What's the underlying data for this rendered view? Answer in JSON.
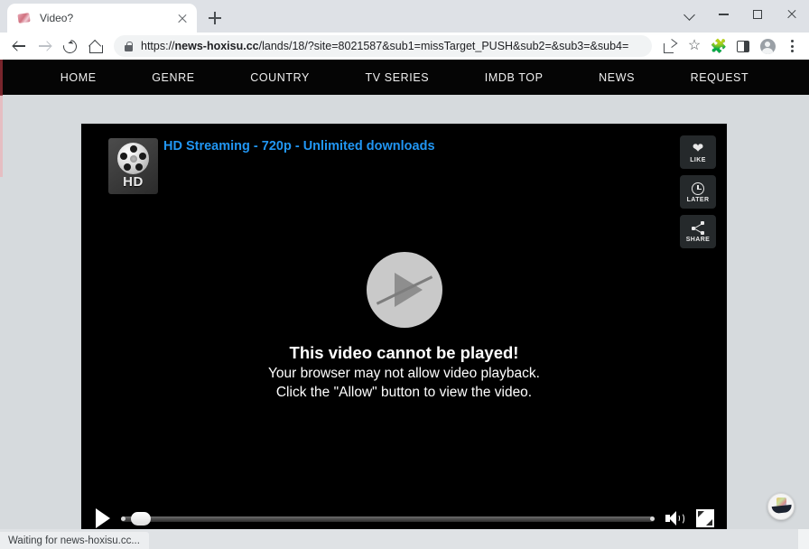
{
  "browser": {
    "tab": {
      "title": "Video?",
      "favicon": "page-favicon",
      "close_icon": "close-icon"
    },
    "new_tab_icon": "plus-icon",
    "window_controls": {
      "tab_search_icon": "chevron-down-icon",
      "minimize_icon": "minimize-icon",
      "maximize_icon": "maximize-icon",
      "close_icon": "close-icon"
    },
    "toolbar": {
      "back_icon": "back-arrow-icon",
      "forward_icon": "forward-arrow-icon",
      "reload_icon": "reload-icon",
      "home_icon": "home-icon",
      "lock_icon": "lock-icon",
      "url": "https://news-hoxisu.cc/lands/18/?site=8021587&sub1=missTarget_PUSH&sub2=&sub3=&sub4=",
      "url_host": "news-hoxisu.cc",
      "url_prefix": "https://",
      "url_path": "/lands/18/?site=8021587&sub1=missTarget_PUSH&sub2=&sub3=&sub4=",
      "share_icon": "share-icon",
      "bookmark_icon": "star-icon",
      "extensions_icon": "puzzle-icon",
      "side_panel_icon": "side-panel-icon",
      "profile_icon": "avatar-icon",
      "menu_icon": "three-dot-menu-icon"
    }
  },
  "site_nav": {
    "items": [
      {
        "label": "HOME"
      },
      {
        "label": "GENRE"
      },
      {
        "label": "COUNTRY"
      },
      {
        "label": "TV SERIES"
      },
      {
        "label": "IMDB TOP"
      },
      {
        "label": "NEWS"
      },
      {
        "label": "REQUEST"
      }
    ]
  },
  "player": {
    "thumbnail": {
      "badge_text": "HD",
      "icon": "film-reel-icon"
    },
    "title": "HD Streaming - 720p - Unlimited downloads",
    "title_color": "#2196f3",
    "side_actions": [
      {
        "label": "LIKE",
        "icon": "heart-icon"
      },
      {
        "label": "LATER",
        "icon": "clock-icon"
      },
      {
        "label": "SHARE",
        "icon": "share-nodes-icon"
      }
    ],
    "overlay": {
      "play_icon": "play-blocked-icon",
      "heading": "This video cannot be played!",
      "line1": "Your browser may not allow video playback.",
      "line2": "Click the \"Allow\" button to view the video."
    },
    "controls": {
      "play_icon": "play-icon",
      "progress_percent": 2,
      "volume_icon": "volume-icon",
      "fullscreen_icon": "fullscreen-icon"
    }
  },
  "float_badge": {
    "icon": "boat-badge-icon"
  },
  "status": {
    "text": "Waiting for news-hoxisu.cc..."
  }
}
